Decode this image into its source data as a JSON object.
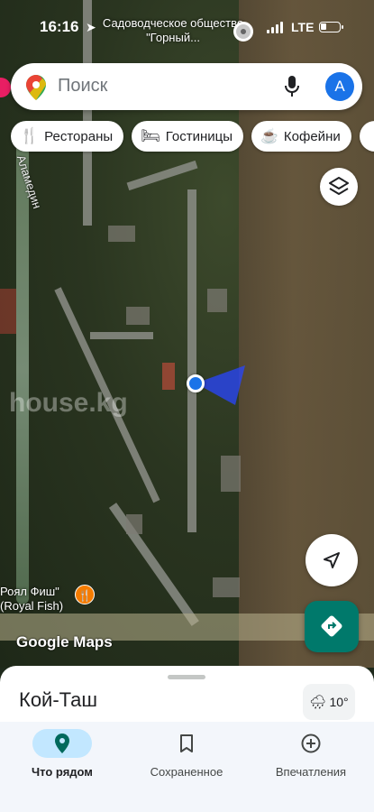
{
  "status_bar": {
    "time": "16:16",
    "location_label": "Садоводческое общество \"Горный...",
    "network": "LTE"
  },
  "search": {
    "placeholder": "Поиск",
    "avatar_letter": "А"
  },
  "chips": [
    {
      "label": "Рестораны",
      "icon": "fork-knife-icon"
    },
    {
      "label": "Гостиницы",
      "icon": "bed-icon"
    },
    {
      "label": "Кофейни",
      "icon": "coffee-icon"
    }
  ],
  "map": {
    "road_name": "Аламедин",
    "watermark": "house.kg",
    "poi_label": "Роял Фиш\"\n(Royal Fish)",
    "attribution": "Google Maps"
  },
  "sheet": {
    "title": "Кой-Таш",
    "weather": "10°"
  },
  "bottom_nav": [
    {
      "label": "Что рядом",
      "icon": "location-pin-icon",
      "active": true
    },
    {
      "label": "Сохраненное",
      "icon": "bookmark-icon",
      "active": false
    },
    {
      "label": "Впечатления",
      "icon": "plus-circle-icon",
      "active": false
    }
  ],
  "colors": {
    "accent": "#1a73e8",
    "directions_button": "#00796b",
    "active_tab_pill": "#c2e7ff"
  }
}
